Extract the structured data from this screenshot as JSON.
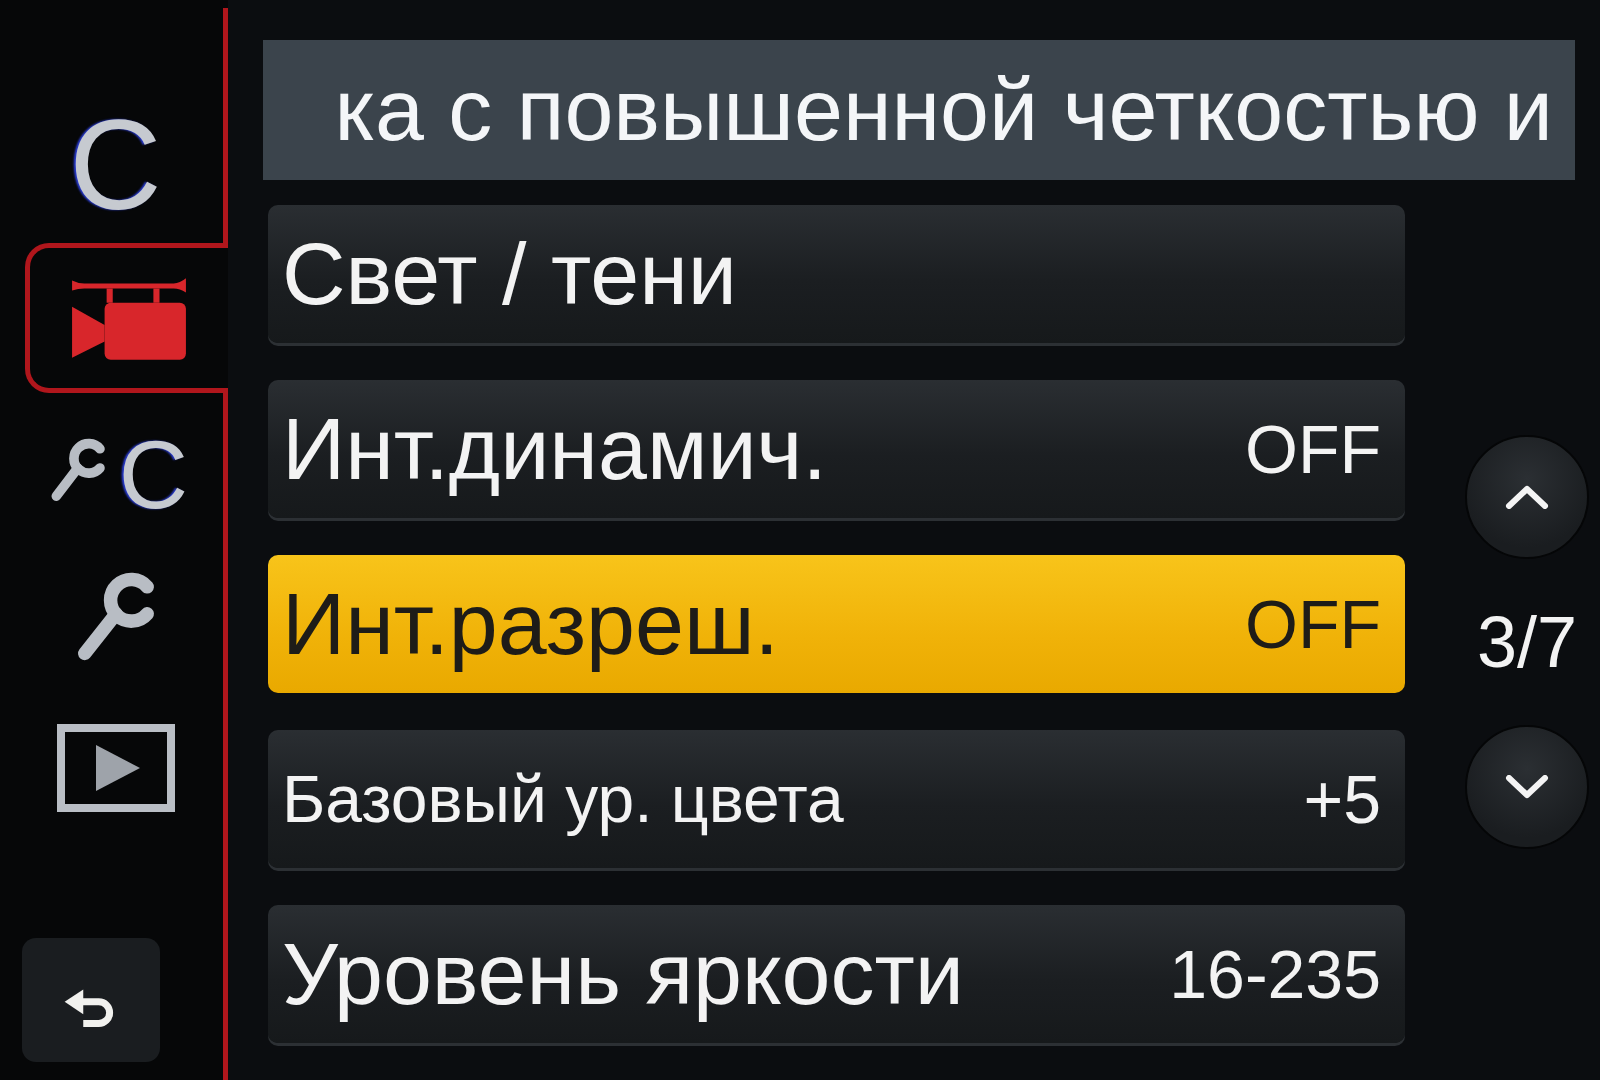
{
  "sidebar": {
    "tabs": [
      {
        "kind": "custom",
        "label": "C",
        "selected": false
      },
      {
        "kind": "video",
        "selected": true
      },
      {
        "kind": "custom_setup",
        "label": "C",
        "selected": false
      },
      {
        "kind": "setup",
        "selected": false
      },
      {
        "kind": "playback",
        "selected": false
      }
    ]
  },
  "banner": {
    "text": "ка с повышенной четкостью и"
  },
  "menu": {
    "items": [
      {
        "label": "Свет / тени",
        "selected": false
      },
      {
        "label": "Инт.динамич.",
        "value": "OFF",
        "selected": false
      },
      {
        "label": "Инт.разреш.",
        "value": "OFF",
        "selected": true
      },
      {
        "label": "Базовый ур. цвета",
        "value": "+5",
        "selected": false
      },
      {
        "label": "Уровень яркости",
        "value": "16-235",
        "selected": false
      }
    ]
  },
  "pager": {
    "page": "3/7"
  }
}
